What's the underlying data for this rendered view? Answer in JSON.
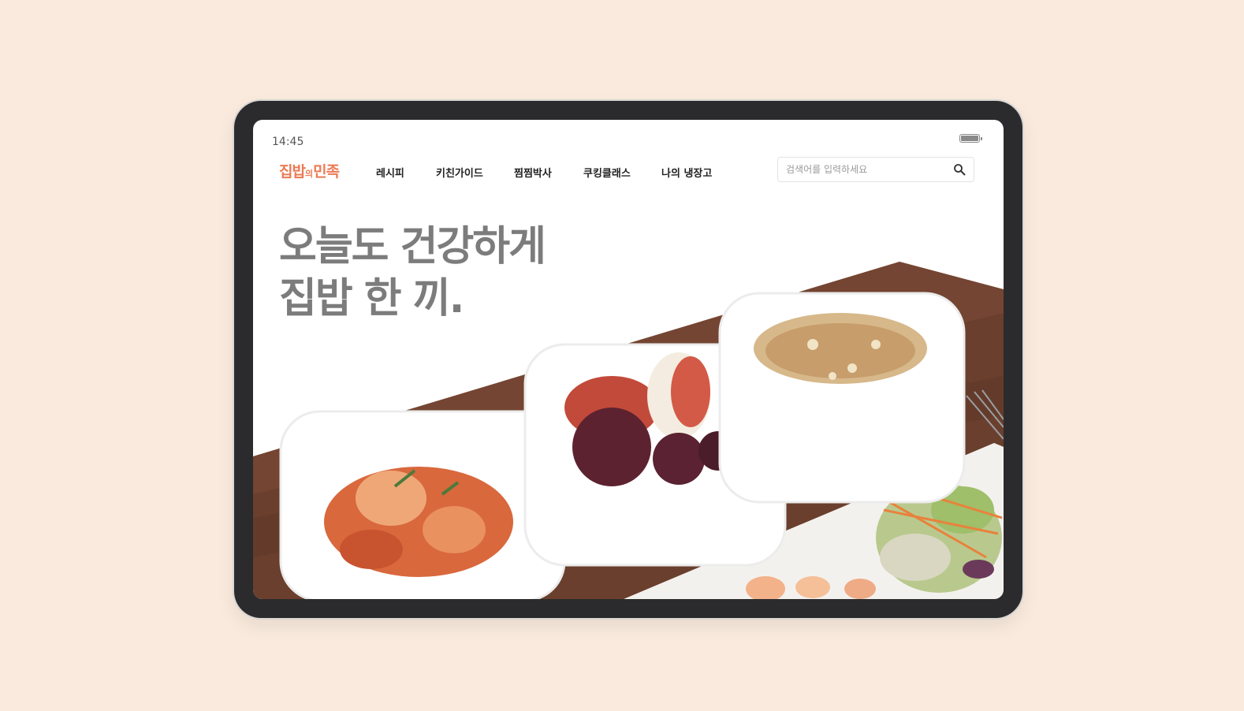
{
  "status_bar": {
    "time": "14:45"
  },
  "header": {
    "logo": {
      "part1": "집밥",
      "part2": "의",
      "part3": "민족"
    },
    "nav": [
      {
        "label": "레시피"
      },
      {
        "label": "키친가이드"
      },
      {
        "label": "찜찜박사"
      },
      {
        "label": "쿠킹클래스"
      },
      {
        "label": "나의 냉장고"
      }
    ],
    "search": {
      "placeholder": "검색어를 입력하세요",
      "value": ""
    }
  },
  "hero": {
    "line1": "오늘도 건강하게",
    "line2": "집밥 한 끼."
  },
  "colors": {
    "background": "#f9eadd",
    "brand": "#ec7a55",
    "headline": "#7c7c7c",
    "tablet_frame": "#2b2b2d"
  },
  "icons": {
    "search": "search-icon",
    "battery": "battery-icon"
  }
}
